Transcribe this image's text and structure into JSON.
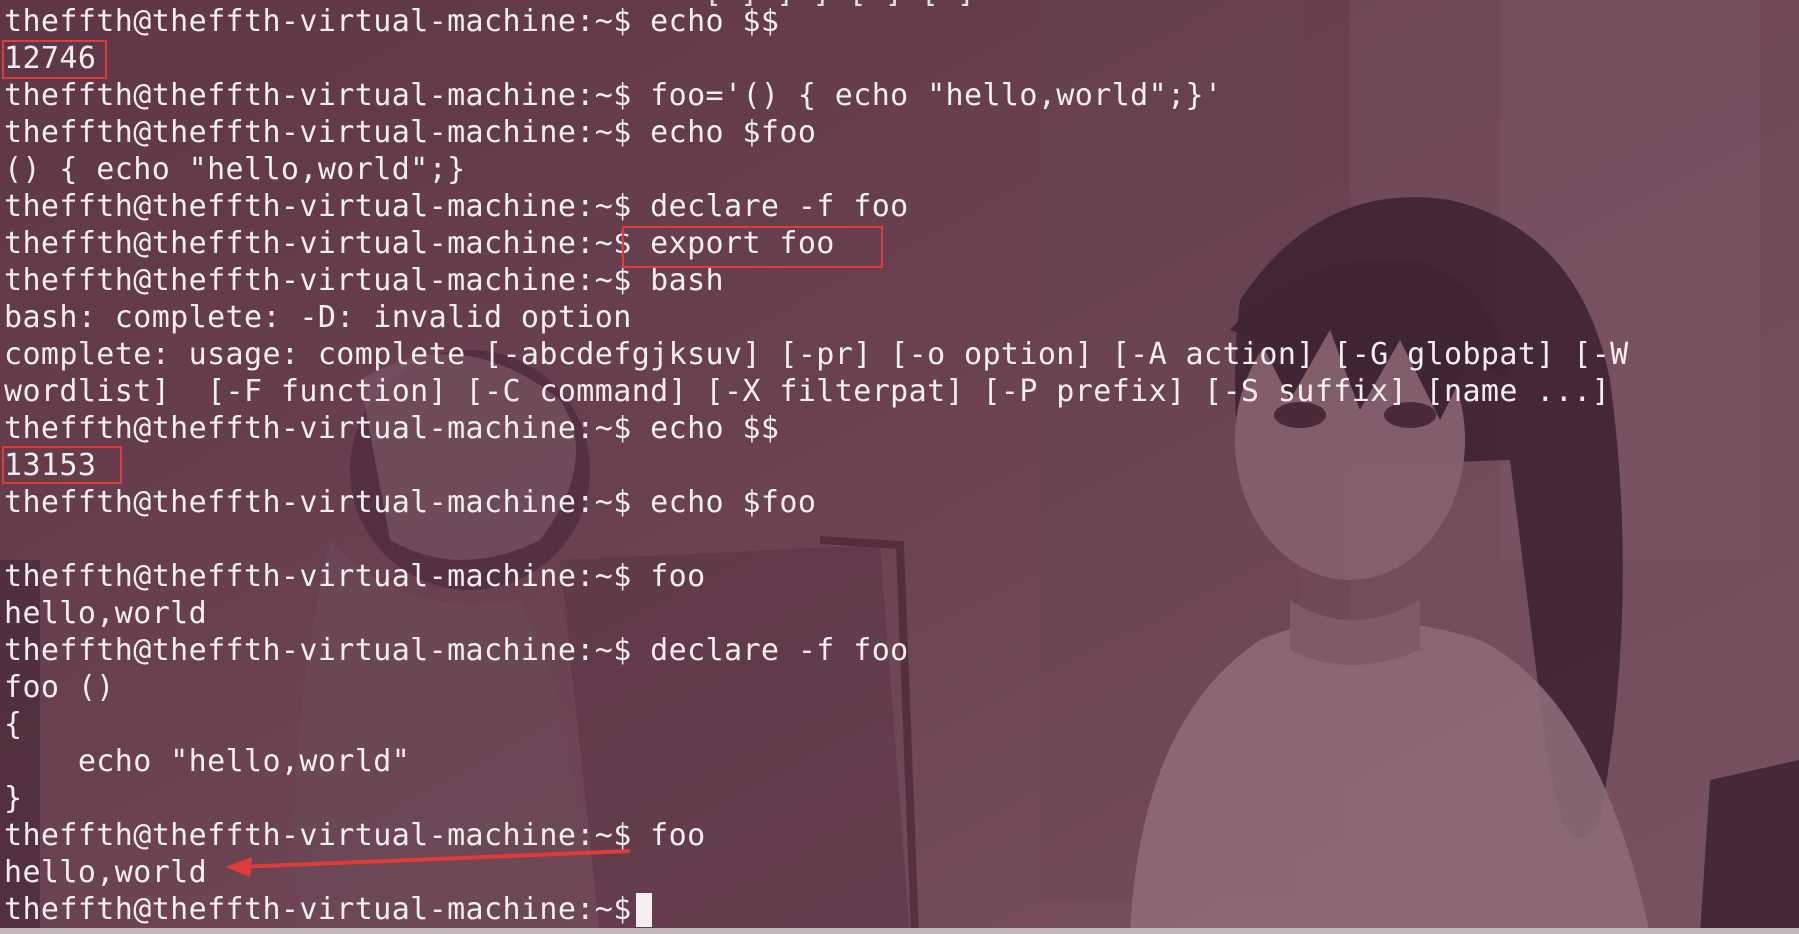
{
  "terminal": {
    "top_cutoff_text": "[ ] ] ] [ ] [ ]",
    "lines": [
      "theffth@theffth-virtual-machine:~$ echo $$",
      "12746",
      "theffth@theffth-virtual-machine:~$ foo='() { echo \"hello,world\";}'",
      "theffth@theffth-virtual-machine:~$ echo $foo",
      "() { echo \"hello,world\";}",
      "theffth@theffth-virtual-machine:~$ declare -f foo",
      "theffth@theffth-virtual-machine:~$ export foo",
      "theffth@theffth-virtual-machine:~$ bash",
      "bash: complete: -D: invalid option",
      "complete: usage: complete [-abcdefgjksuv] [-pr] [-o option] [-A action] [-G globpat] [-W",
      "wordlist]  [-F function] [-C command] [-X filterpat] [-P prefix] [-S suffix] [name ...]",
      "theffth@theffth-virtual-machine:~$ echo $$",
      "13153",
      "theffth@theffth-virtual-machine:~$ echo $foo",
      "",
      "theffth@theffth-virtual-machine:~$ foo",
      "hello,world",
      "theffth@theffth-virtual-machine:~$ declare -f foo",
      "foo ()",
      "{",
      "    echo \"hello,world\"",
      "}",
      "theffth@theffth-virtual-machine:~$ foo",
      "hello,world",
      "theffth@theffth-virtual-machine:~$ "
    ]
  },
  "colors": {
    "background": "#5a3443",
    "text": "#f4eef0",
    "annotation_red": "#e03b3b"
  }
}
